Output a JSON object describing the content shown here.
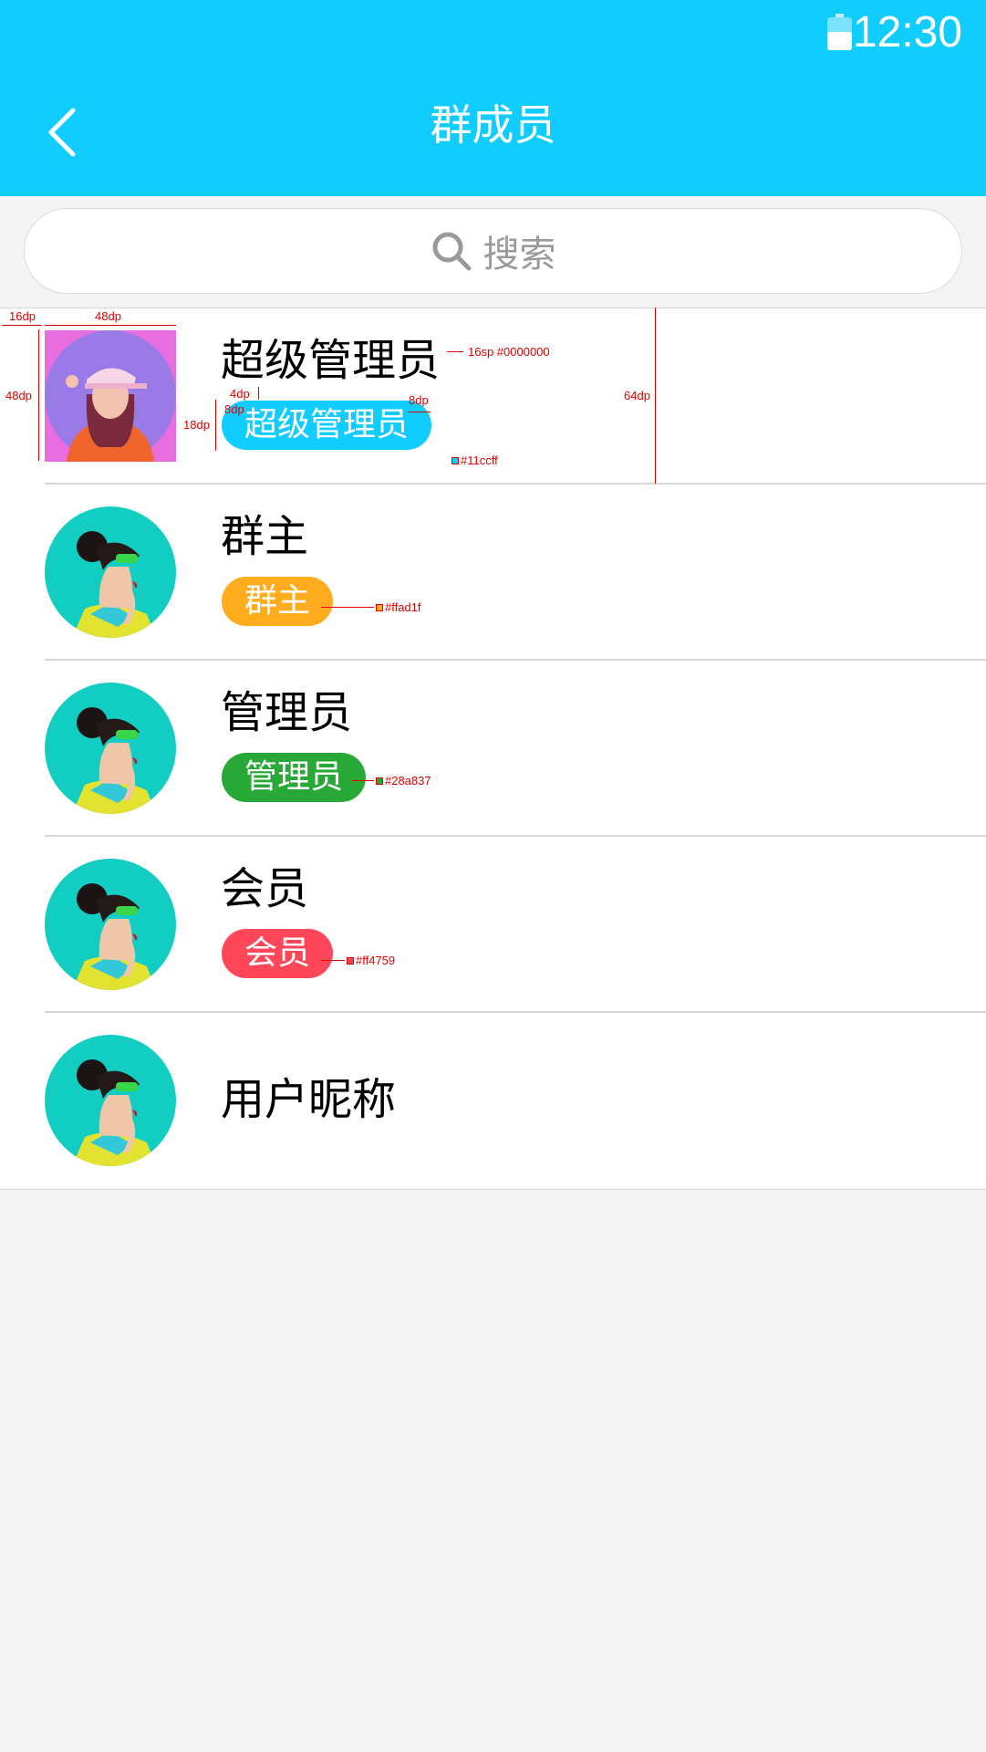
{
  "status_bar": {
    "time": "12:30",
    "battery_icon": "battery-icon"
  },
  "header": {
    "title": "群成员",
    "back_icon": "chevron-left-icon",
    "background": "#11ccff"
  },
  "search": {
    "placeholder": "搜索",
    "icon": "search-icon"
  },
  "members": [
    {
      "name": "超级管理员",
      "role": "超级管理员",
      "role_color": "#11ccff",
      "avatar": "avatar-woman-pink-cap"
    },
    {
      "name": "群主",
      "role": "群主",
      "role_color": "#ffad1f",
      "avatar": "avatar-woman-sunglasses"
    },
    {
      "name": "管理员",
      "role": "管理员",
      "role_color": "#28a837",
      "avatar": "avatar-woman-sunglasses"
    },
    {
      "name": "会员",
      "role": "会员",
      "role_color": "#ff4759",
      "avatar": "avatar-woman-sunglasses"
    },
    {
      "name": "用户昵称",
      "role": "",
      "avatar": "avatar-woman-sunglasses"
    }
  ],
  "annotations": {
    "left_margin": "16dp",
    "avatar_width": "48dp",
    "avatar_height": "48dp",
    "name_spec": "16sp #0000000",
    "gap": "4dp",
    "badge_padding_left": "8dp",
    "badge_padding_right": "8dp",
    "badge_height": "18dp",
    "row_height": "64dp",
    "color_super_admin": "#11ccff",
    "color_owner": "#ffad1f",
    "color_admin": "#28a837",
    "color_member": "#ff4759"
  }
}
